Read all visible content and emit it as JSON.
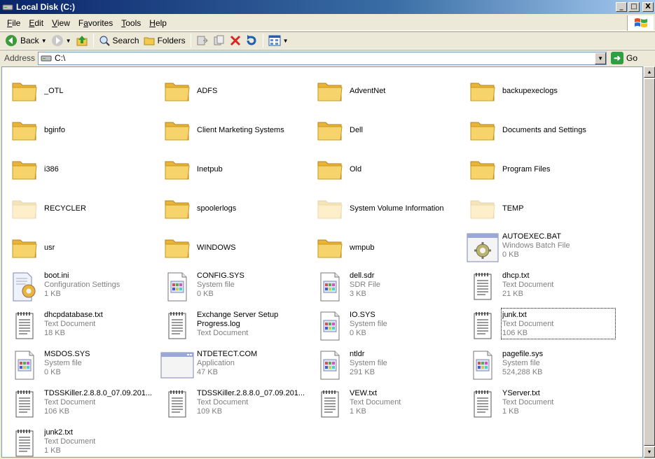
{
  "window": {
    "title": "Local Disk (C:)",
    "icon": "drive-icon"
  },
  "title_buttons": {
    "minimize": "_",
    "maximize": "□",
    "close": "X"
  },
  "menu": [
    {
      "label": "File",
      "accel": "F"
    },
    {
      "label": "Edit",
      "accel": "E"
    },
    {
      "label": "View",
      "accel": "V"
    },
    {
      "label": "Favorites",
      "accel": "a"
    },
    {
      "label": "Tools",
      "accel": "T"
    },
    {
      "label": "Help",
      "accel": "H"
    }
  ],
  "toolbar": {
    "back": "Back",
    "search": "Search",
    "folders": "Folders"
  },
  "address": {
    "label": "Address",
    "value": "C:\\",
    "go": "Go"
  },
  "items": [
    {
      "name": "_OTL",
      "kind": "folder"
    },
    {
      "name": "ADFS",
      "kind": "folder"
    },
    {
      "name": "AdventNet",
      "kind": "folder"
    },
    {
      "name": "backupexeclogs",
      "kind": "folder"
    },
    {
      "name": "bginfo",
      "kind": "folder"
    },
    {
      "name": "Client Marketing Systems",
      "kind": "folder"
    },
    {
      "name": "Dell",
      "kind": "folder"
    },
    {
      "name": "Documents and Settings",
      "kind": "folder"
    },
    {
      "name": "i386",
      "kind": "folder"
    },
    {
      "name": "Inetpub",
      "kind": "folder"
    },
    {
      "name": "Old",
      "kind": "folder"
    },
    {
      "name": "Program Files",
      "kind": "folder"
    },
    {
      "name": "RECYCLER",
      "kind": "folder-faded"
    },
    {
      "name": "spoolerlogs",
      "kind": "folder"
    },
    {
      "name": "System Volume Information",
      "kind": "folder-faded"
    },
    {
      "name": "TEMP",
      "kind": "folder-faded"
    },
    {
      "name": "usr",
      "kind": "folder"
    },
    {
      "name": "WINDOWS",
      "kind": "folder"
    },
    {
      "name": "wmpub",
      "kind": "folder"
    },
    {
      "name": "AUTOEXEC.BAT",
      "type": "Windows Batch File",
      "size": "0 KB",
      "kind": "batch"
    },
    {
      "name": "boot.ini",
      "type": "Configuration Settings",
      "size": "1 KB",
      "kind": "config"
    },
    {
      "name": "CONFIG.SYS",
      "type": "System file",
      "size": "0 KB",
      "kind": "sysfile"
    },
    {
      "name": "dell.sdr",
      "type": "SDR File",
      "size": "3 KB",
      "kind": "sysfile"
    },
    {
      "name": "dhcp.txt",
      "type": "Text Document",
      "size": "21 KB",
      "kind": "text"
    },
    {
      "name": "dhcpdatabase.txt",
      "type": "Text Document",
      "size": "18 KB",
      "kind": "text"
    },
    {
      "name": "Exchange Server Setup Progress.log",
      "type": "Text Document",
      "size": "",
      "kind": "text",
      "wrap": true
    },
    {
      "name": "IO.SYS",
      "type": "System file",
      "size": "0 KB",
      "kind": "sysfile"
    },
    {
      "name": "junk.txt",
      "type": "Text Document",
      "size": "106 KB",
      "kind": "text",
      "selected": true
    },
    {
      "name": "MSDOS.SYS",
      "type": "System file",
      "size": "0 KB",
      "kind": "sysfile"
    },
    {
      "name": "NTDETECT.COM",
      "type": "Application",
      "size": "47 KB",
      "kind": "app"
    },
    {
      "name": "ntldr",
      "type": "System file",
      "size": "291 KB",
      "kind": "sysfile"
    },
    {
      "name": "pagefile.sys",
      "type": "System file",
      "size": "524,288 KB",
      "kind": "sysfile"
    },
    {
      "name": "TDSSKiller.2.8.8.0_07.09.201...",
      "type": "Text Document",
      "size": "106 KB",
      "kind": "text"
    },
    {
      "name": "TDSSKiller.2.8.8.0_07.09.201...",
      "type": "Text Document",
      "size": "109 KB",
      "kind": "text"
    },
    {
      "name": "VEW.txt",
      "type": "Text Document",
      "size": "1 KB",
      "kind": "text"
    },
    {
      "name": "YServer.txt",
      "type": "Text Document",
      "size": "1 KB",
      "kind": "text"
    },
    {
      "name": "junk2.txt",
      "type": "Text Document",
      "size": "1 KB",
      "kind": "text"
    }
  ]
}
